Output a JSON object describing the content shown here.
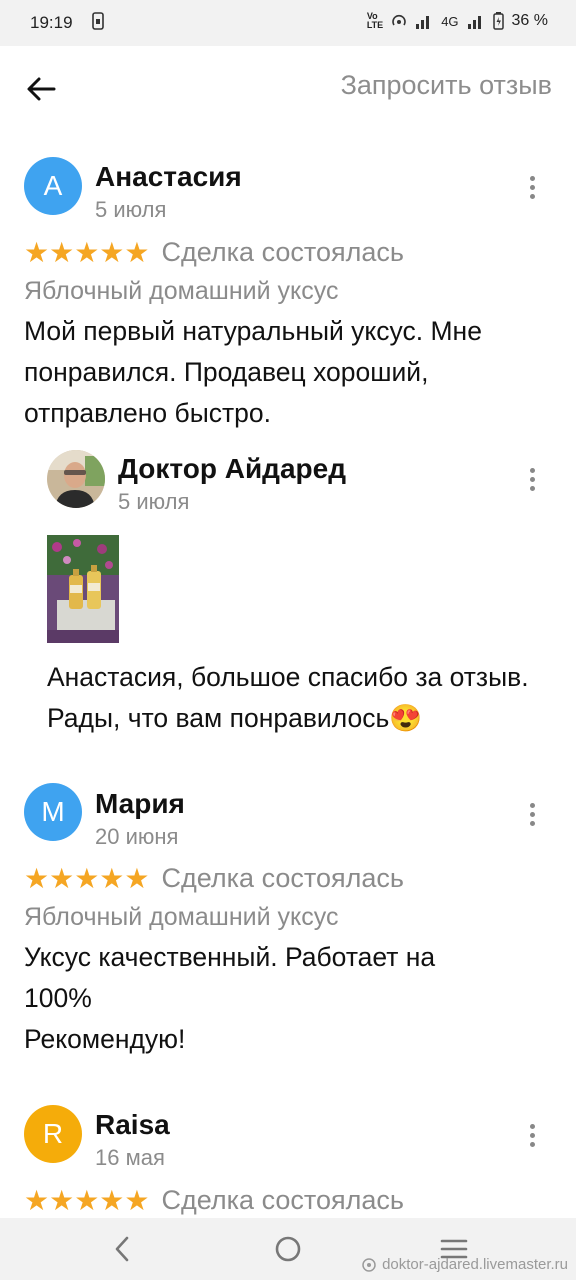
{
  "status_bar": {
    "time": "19:19",
    "network_label": "4G",
    "battery": "36 %"
  },
  "header": {
    "back_icon": "arrow-left-icon",
    "request_label": "Запросить отзыв"
  },
  "reviews": [
    {
      "avatar_letter": "А",
      "avatar_color": "#3fa3f0",
      "name": "Анастасия",
      "date": "5 июля",
      "stars": "★★★★★",
      "deal": "Сделка состоялась",
      "product": "Яблочный домашний уксус",
      "text": "Мой первый натуральный уксус. Мне понравился. Продавец хороший, отправлено быстро.",
      "reply": {
        "name": "Доктор Айдаред",
        "date": "5 июля",
        "text": "Анастасия, большое спасибо за отзыв. Рады, что вам понравилось😍"
      }
    },
    {
      "avatar_letter": "М",
      "avatar_color": "#3fa3f0",
      "name": "Мария",
      "date": "20 июня",
      "stars": "★★★★★",
      "deal": "Сделка состоялась",
      "product": "Яблочный домашний уксус",
      "text_line1": "Уксус качественный. Работает на 100%",
      "text_line2": "Рекомендую!"
    },
    {
      "avatar_letter": "R",
      "avatar_color": "#f5ac0a",
      "name": "Raisa",
      "date": "16 мая",
      "stars": "★★★★★",
      "deal": "Сделка состоялась"
    }
  ],
  "watermark": "doktor-ajdared.livemaster.ru",
  "colors": {
    "star": "#f5a623",
    "muted": "#8b8b8b",
    "accent_avatar": "#3fa3f0"
  }
}
